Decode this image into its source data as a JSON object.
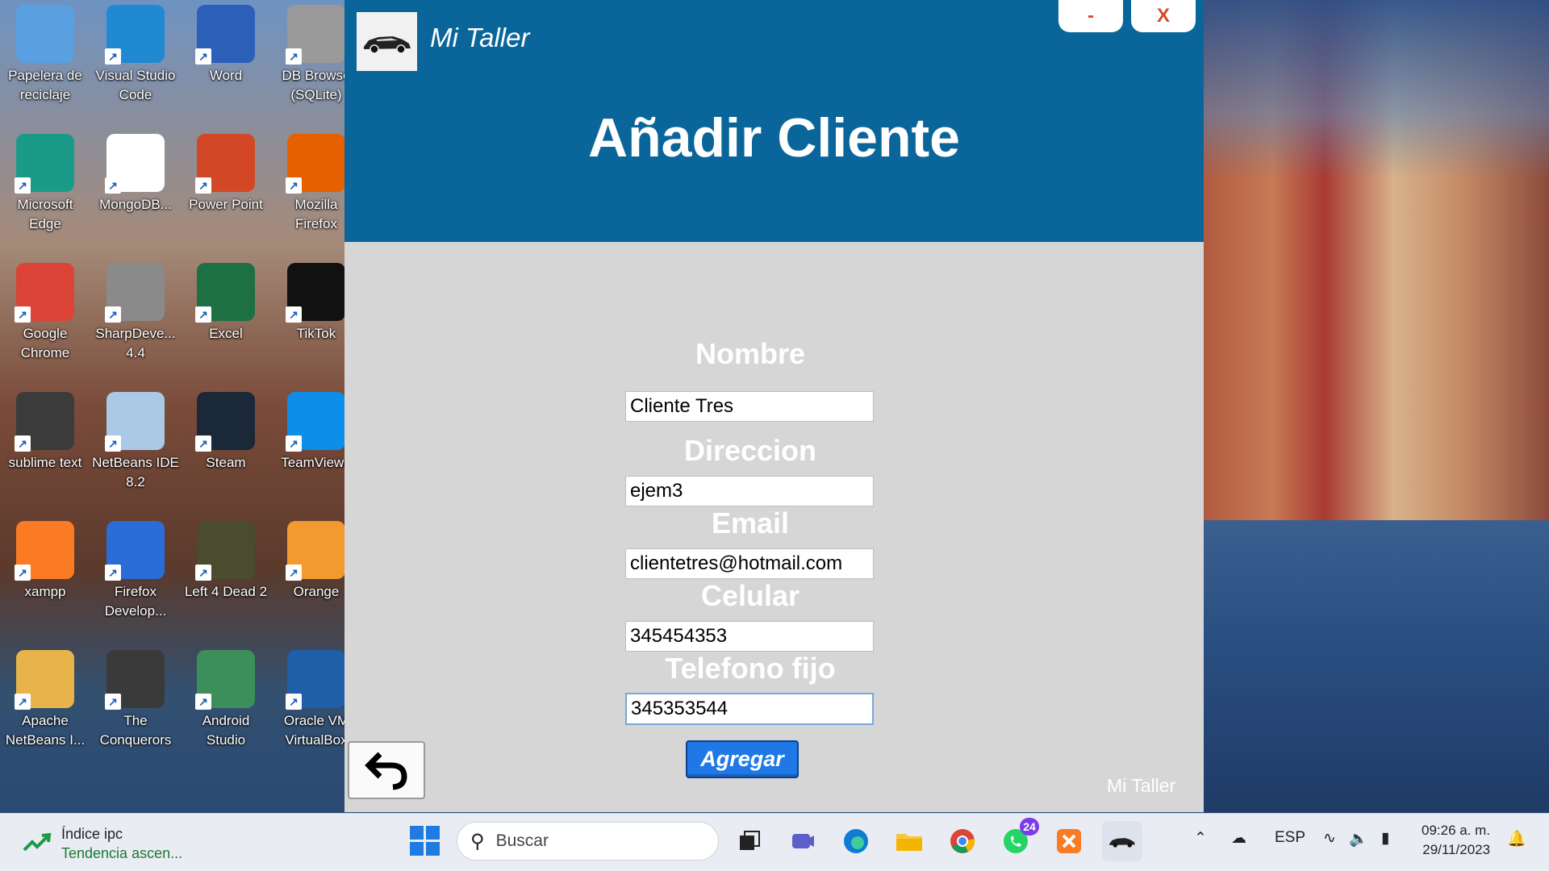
{
  "desktop": {
    "icons": [
      {
        "label": "Papelera de\nreciclaje",
        "icon": "recycle-bin-icon",
        "color": "#5aa0e0"
      },
      {
        "label": "Visual Studio\nCode",
        "icon": "vscode-icon",
        "color": "#1f8ad2"
      },
      {
        "label": "Word",
        "icon": "word-icon",
        "color": "#2b5fb8"
      },
      {
        "label": "DB Browse\n(SQLite)",
        "icon": "db-browser-icon",
        "color": "#9a9a9a"
      },
      {
        "label": "Microsoft\nEdge",
        "icon": "edge-icon",
        "color": "#1a9b8a"
      },
      {
        "label": "MongoDB...",
        "icon": "mongodb-icon",
        "color": "#ffffff"
      },
      {
        "label": "Power Point",
        "icon": "powerpoint-icon",
        "color": "#d24726"
      },
      {
        "label": "Mozilla\nFirefox",
        "icon": "firefox-icon",
        "color": "#e66000"
      },
      {
        "label": "Google\nChrome",
        "icon": "chrome-icon",
        "color": "#db4437"
      },
      {
        "label": "SharpDeve...\n4.4",
        "icon": "sharpdevelop-icon",
        "color": "#8a8a8a"
      },
      {
        "label": "Excel",
        "icon": "excel-icon",
        "color": "#1d7044"
      },
      {
        "label": "TikTok",
        "icon": "tiktok-icon",
        "color": "#111111"
      },
      {
        "label": "sublime text",
        "icon": "sublime-icon",
        "color": "#3b3b3b"
      },
      {
        "label": "NetBeans IDE\n8.2",
        "icon": "netbeans-icon",
        "color": "#a9c9e6"
      },
      {
        "label": "Steam",
        "icon": "steam-icon",
        "color": "#1b2838"
      },
      {
        "label": "TeamViewe",
        "icon": "teamviewer-icon",
        "color": "#0e8ee9"
      },
      {
        "label": "xampp",
        "icon": "xampp-icon",
        "color": "#fb7a24"
      },
      {
        "label": "Firefox\nDevelop...",
        "icon": "firefox-dev-icon",
        "color": "#2a6cd8"
      },
      {
        "label": "Left 4 Dead 2",
        "icon": "left4dead-icon",
        "color": "#4b4b2f"
      },
      {
        "label": "Orange",
        "icon": "orange-icon",
        "color": "#f29a2e"
      },
      {
        "label": "Apache\nNetBeans I...",
        "icon": "apache-netbeans-icon",
        "color": "#e8b44a"
      },
      {
        "label": "The\nConquerors",
        "icon": "conquerors-icon",
        "color": "#3a3a3a"
      },
      {
        "label": "Android\nStudio",
        "icon": "android-studio-icon",
        "color": "#3c8e5a"
      },
      {
        "label": "Oracle VM\nVirtualBox",
        "icon": "virtualbox-icon",
        "color": "#1f5fa8"
      }
    ]
  },
  "app": {
    "title": "Mi Taller",
    "logo_text": "MI TALLER",
    "minimize_label": "-",
    "close_label": "X",
    "page_title": "Añadir Cliente",
    "header_color": "#0a669a",
    "form": {
      "nombre_label": "Nombre",
      "nombre_value": "Cliente Tres",
      "direccion_label": "Direccion",
      "direccion_value": "ejem3",
      "email_label": "Email",
      "email_value": "clientetres@hotmail.com",
      "celular_label": "Celular",
      "celular_value": "345454353",
      "telefono_label": "Telefono fijo",
      "telefono_value": "345353544"
    },
    "agregar_label": "Agregar",
    "back_icon": "undo-arrow-icon",
    "footer_brand": "Mi Taller"
  },
  "taskbar": {
    "widget_title": "Índice ipc",
    "widget_subtitle": "Tendencia ascen...",
    "search_placeholder": "Buscar",
    "whatsapp_badge": "24",
    "language": "ESP",
    "time": "09:26 a. m.",
    "date": "29/11/2023"
  }
}
